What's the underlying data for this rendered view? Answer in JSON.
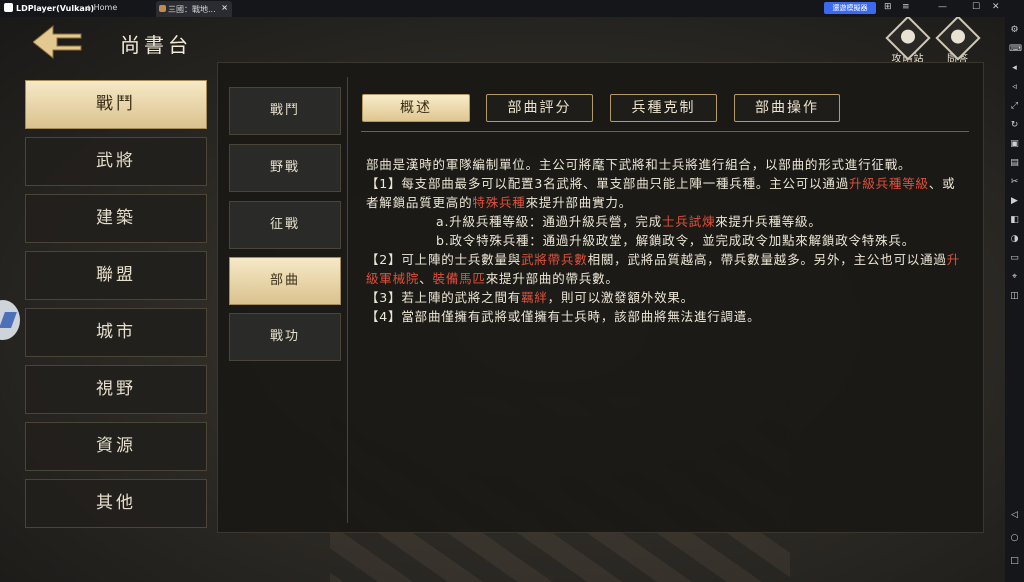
{
  "titlebar": {
    "brand": "LDPlayer(Vulkan)",
    "home": "Home",
    "tab": "三國：戰地...",
    "tab_close": "×",
    "speed_btn": "還遊模擬器",
    "controls": [
      "⊞",
      "≡",
      "—",
      "☐",
      "✕"
    ]
  },
  "header": {
    "title": "尚書台",
    "guide": "攻略站",
    "faq": "問答"
  },
  "categories": [
    "戰鬥",
    "武將",
    "建築",
    "聯盟",
    "城市",
    "視野",
    "資源",
    "其他"
  ],
  "subcategories": [
    "戰鬥",
    "野戰",
    "征戰",
    "部曲",
    "戰功"
  ],
  "tabs": [
    "概述",
    "部曲評分",
    "兵種克制",
    "部曲操作"
  ],
  "content": {
    "intro": "部曲是漢時的軍隊編制單位。主公可將麾下武將和士兵將進行組合，以部曲的形式進行征戰。",
    "p1_a": "【1】每支部曲最多可以配置3名武將、單支部曲只能上陣一種兵種。主公可以通過",
    "p1_hl1": "升級兵種等級",
    "p1_b": "、或者解鎖品質更高的",
    "p1_hl2": "特殊兵種",
    "p1_c": "來提升部曲實力。",
    "p1_sub_a1": "a.升級兵種等級：通過升級兵營，完成",
    "p1_sub_a_hl": "士兵試煉",
    "p1_sub_a2": "來提升兵種等級。",
    "p1_sub_b": "b.政令特殊兵種：通過升級政堂，解鎖政令，並完成政令加點來解鎖政令特殊兵。",
    "p2_a": "【2】可上陣的士兵數量與",
    "p2_hl1": "武將帶兵數",
    "p2_b": "相關，武將品質越高，帶兵數量越多。另外，主公也可以通過",
    "p2_hl2": "升級軍械院",
    "p2_c": "、",
    "p2_hl3": "裝備馬匹",
    "p2_d": "來提升部曲的帶兵數。",
    "p3_a": "【3】若上陣的武將之間有",
    "p3_hl": "羈絆",
    "p3_b": "，則可以激發額外效果。",
    "p4": "【4】當部曲僅擁有武將或僅擁有士兵時，該部曲將無法進行調遣。"
  },
  "colors": {
    "highlight": "#e0503a",
    "active_bg": "#dbc28f",
    "text": "#ece6d6"
  }
}
